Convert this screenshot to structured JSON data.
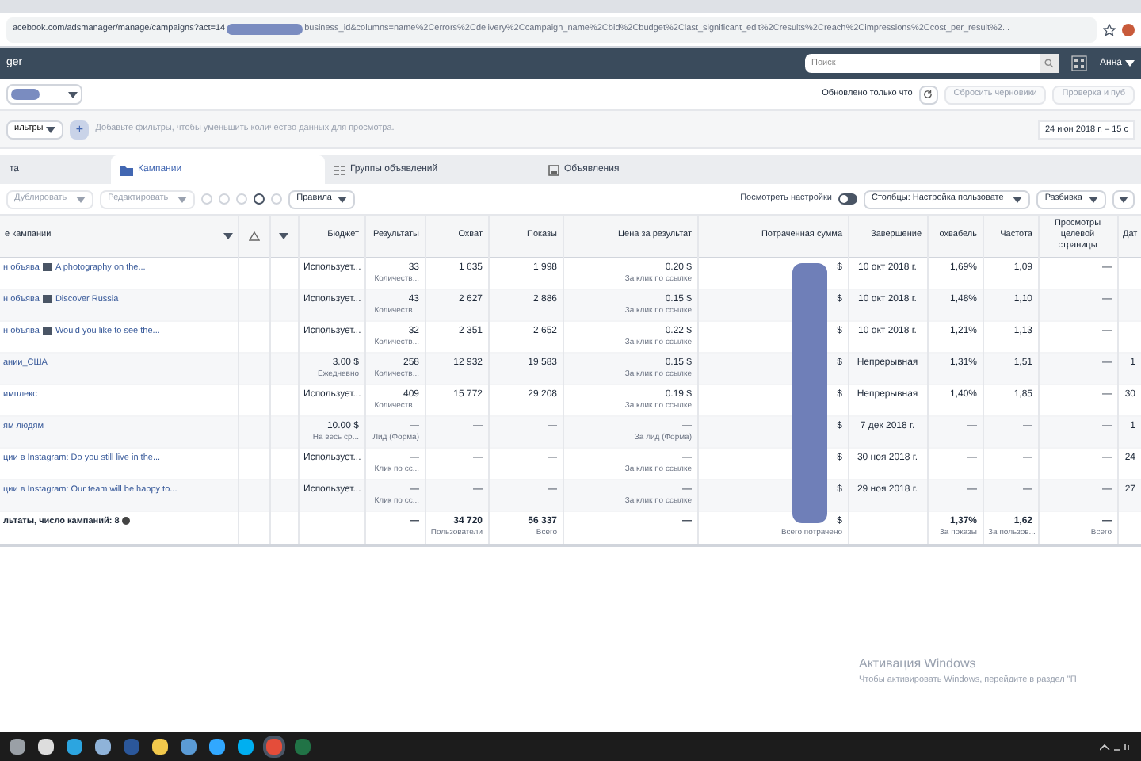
{
  "browser": {
    "url_start": "acebook.com/adsmanager/manage/campaigns?act=14",
    "url_end": "business_id&columns=name%2Cerrors%2Cdelivery%2Ccampaign_name%2Cbid%2Cbudget%2Clast_significant_edit%2Cresults%2Creach%2Cimpressions%2Ccost_per_result%2..."
  },
  "header": {
    "title": "ger",
    "search": {
      "placeholder": "Поиск"
    },
    "user": "Анна"
  },
  "status": {
    "updated": "Обновлено только что",
    "buttons": [
      {
        "label": "Сбросить черновики",
        "disabled": true
      },
      {
        "label": "Проверка и пуб",
        "disabled": true
      }
    ]
  },
  "filters": {
    "button": "ильтры",
    "add": "+",
    "placeholder": "Добавьте фильтры, чтобы уменьшить количество данных для просмотра.",
    "date": "24 июн 2018 г. – 15 с"
  },
  "tabs": [
    {
      "label": "та",
      "selected": false
    },
    {
      "label": "Кампании",
      "selected": true
    },
    {
      "label": "Группы объявлений",
      "selected": false
    },
    {
      "label": "Объявления",
      "selected": false
    }
  ],
  "toolbar": {
    "actions": [
      {
        "label": "Дублировать",
        "disabled": true
      },
      {
        "label": "Редактировать",
        "disabled": true
      }
    ],
    "rules": "Правила",
    "view_settings": {
      "label": "Посмотреть настройки",
      "on": false
    },
    "columns": "Столбцы: Настройка пользовате",
    "breakdown": "Разбивка"
  },
  "table": {
    "name_column": "е кампании",
    "columns": [
      "Бюджет",
      "Результаты",
      "Охват",
      "Показы",
      "Цена за результат",
      "Потраченная сумма",
      "Завершение",
      "охвабель",
      "Частота",
      "Просмотры целевой страницы",
      "Дат"
    ],
    "rows": [
      {
        "name": "н объява",
        "thumbnail": true,
        "link": "A photography on the...",
        "cells": [
          [
            "Использует..."
          ],
          [
            "33",
            "Количеств..."
          ],
          [
            "1 635"
          ],
          [
            "1 998"
          ],
          [
            "0.20 $",
            "За клик по ссылке"
          ],
          [
            "$"
          ],
          [
            "10 окт 2018 г."
          ],
          [
            "1,69%"
          ],
          [
            "1,09"
          ],
          [
            "—"
          ],
          []
        ]
      },
      {
        "name": "н объява",
        "thumbnail": true,
        "link": "Discover Russia",
        "cells": [
          [
            "Использует..."
          ],
          [
            "43",
            "Количеств..."
          ],
          [
            "2 627"
          ],
          [
            "2 886"
          ],
          [
            "0.15 $",
            "За клик по ссылке"
          ],
          [
            "$"
          ],
          [
            "10 окт 2018 г."
          ],
          [
            "1,48%"
          ],
          [
            "1,10"
          ],
          [
            "—"
          ],
          []
        ]
      },
      {
        "name": "н объява",
        "thumbnail": true,
        "link": "Would you like to see the...",
        "cells": [
          [
            "Использует..."
          ],
          [
            "32",
            "Количеств..."
          ],
          [
            "2 351"
          ],
          [
            "2 652"
          ],
          [
            "0.22 $",
            "За клик по ссылке"
          ],
          [
            "$"
          ],
          [
            "10 окт 2018 г."
          ],
          [
            "1,21%"
          ],
          [
            "1,13"
          ],
          [
            "—"
          ],
          []
        ]
      },
      {
        "name": "ании_США",
        "thumbnail": false,
        "cells": [
          [
            "3.00 $",
            "Ежедневно"
          ],
          [
            "258",
            "Количеств..."
          ],
          [
            "12 932"
          ],
          [
            "19 583"
          ],
          [
            "0.15 $",
            "За клик по ссылке"
          ],
          [
            "$"
          ],
          [
            "Непрерывная"
          ],
          [
            "1,31%"
          ],
          [
            "1,51"
          ],
          [
            "—"
          ],
          [
            "1"
          ]
        ]
      },
      {
        "name": "имплекс",
        "thumbnail": false,
        "cells": [
          [
            "Использует..."
          ],
          [
            "409",
            "Количеств..."
          ],
          [
            "15 772"
          ],
          [
            "29 208"
          ],
          [
            "0.19 $",
            "За клик по ссылке"
          ],
          [
            "$"
          ],
          [
            "Непрерывная"
          ],
          [
            "1,40%"
          ],
          [
            "1,85"
          ],
          [
            "—"
          ],
          [
            "30"
          ]
        ]
      },
      {
        "name": "ям людям",
        "thumbnail": false,
        "cells": [
          [
            "10.00 $",
            "На весь ср..."
          ],
          [
            "—",
            "Лид (Форма)"
          ],
          [
            "—"
          ],
          [
            "—"
          ],
          [
            "—",
            "За лид (Форма)"
          ],
          [
            "$"
          ],
          [
            "7 дек 2018 г."
          ],
          [
            "—"
          ],
          [
            "—"
          ],
          [
            "—"
          ],
          [
            "1"
          ]
        ]
      },
      {
        "name": "ции в Instagram: Do you still live in the...",
        "thumbnail": false,
        "cells": [
          [
            "Использует..."
          ],
          [
            "—",
            "Клик по сс..."
          ],
          [
            "—"
          ],
          [
            "—"
          ],
          [
            "—",
            "За клик по ссылке"
          ],
          [
            "$"
          ],
          [
            "30 ноя 2018 г."
          ],
          [
            "—"
          ],
          [
            "—"
          ],
          [
            "—"
          ],
          [
            "24"
          ]
        ]
      },
      {
        "name": "ции в Instagram: Our team will be happy to...",
        "thumbnail": false,
        "cells": [
          [
            "Использует..."
          ],
          [
            "—",
            "Клик по сс..."
          ],
          [
            "—"
          ],
          [
            "—"
          ],
          [
            "—",
            "За клик по ссылке"
          ],
          [
            "$"
          ],
          [
            "29 ноя 2018 г."
          ],
          [
            "—"
          ],
          [
            "—"
          ],
          [
            "—"
          ],
          [
            "27"
          ]
        ]
      }
    ],
    "total": {
      "name": "льтаты, число кампаний: 8",
      "cells": [
        [],
        [
          "—"
        ],
        [
          "34 720",
          "Пользователи"
        ],
        [
          "56 337",
          "Всего"
        ],
        [
          "—"
        ],
        [
          "$",
          "Всего потрачено"
        ],
        [],
        [
          "1,37%",
          "За показы"
        ],
        [
          "1,62",
          "За пользов..."
        ],
        [
          "—",
          "Всего"
        ],
        []
      ]
    }
  },
  "activation": {
    "title": "Активация Windows",
    "text": "Чтобы активировать Windows, перейдите в раздел \"П"
  }
}
